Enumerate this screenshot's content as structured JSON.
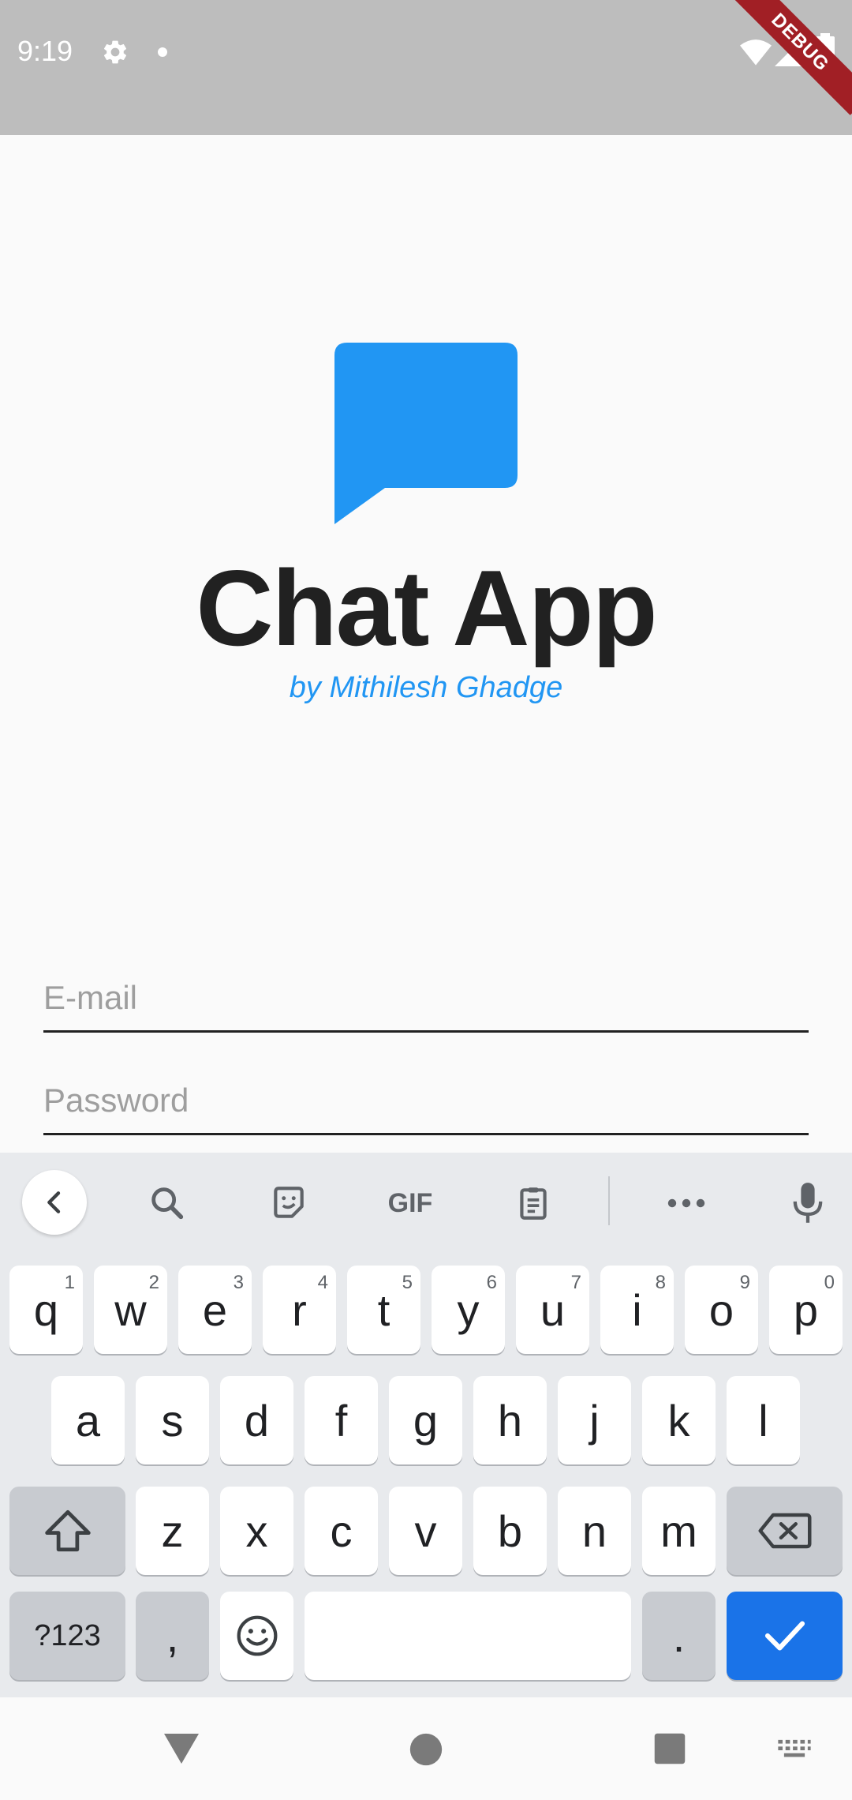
{
  "status_bar": {
    "time": "9:19",
    "debug_label": "DEBUG"
  },
  "app": {
    "title": "Chat App",
    "subtitle": "by Mithilesh Ghadge",
    "logo_color": "#2196f3"
  },
  "form": {
    "email_placeholder": "E-mail",
    "password_placeholder": "Password"
  },
  "keyboard": {
    "toolbar": {
      "gif_label": "GIF",
      "icons": [
        "chevron-left-icon",
        "search-icon",
        "sticker-icon",
        "gif-icon",
        "clipboard-icon",
        "more-icon",
        "mic-icon"
      ]
    },
    "row1": [
      {
        "key": "q",
        "hint": "1"
      },
      {
        "key": "w",
        "hint": "2"
      },
      {
        "key": "e",
        "hint": "3"
      },
      {
        "key": "r",
        "hint": "4"
      },
      {
        "key": "t",
        "hint": "5"
      },
      {
        "key": "y",
        "hint": "6"
      },
      {
        "key": "u",
        "hint": "7"
      },
      {
        "key": "i",
        "hint": "8"
      },
      {
        "key": "o",
        "hint": "9"
      },
      {
        "key": "p",
        "hint": "0"
      }
    ],
    "row2": [
      "a",
      "s",
      "d",
      "f",
      "g",
      "h",
      "j",
      "k",
      "l"
    ],
    "row3": [
      "z",
      "x",
      "c",
      "v",
      "b",
      "n",
      "m"
    ],
    "row4": {
      "symbols": "?123",
      "comma": ",",
      "period": "."
    },
    "accent_color": "#1a73e8"
  },
  "nav_bar": {
    "icons": [
      "back-icon",
      "home-icon",
      "recents-icon",
      "keyboard-switch-icon"
    ]
  }
}
